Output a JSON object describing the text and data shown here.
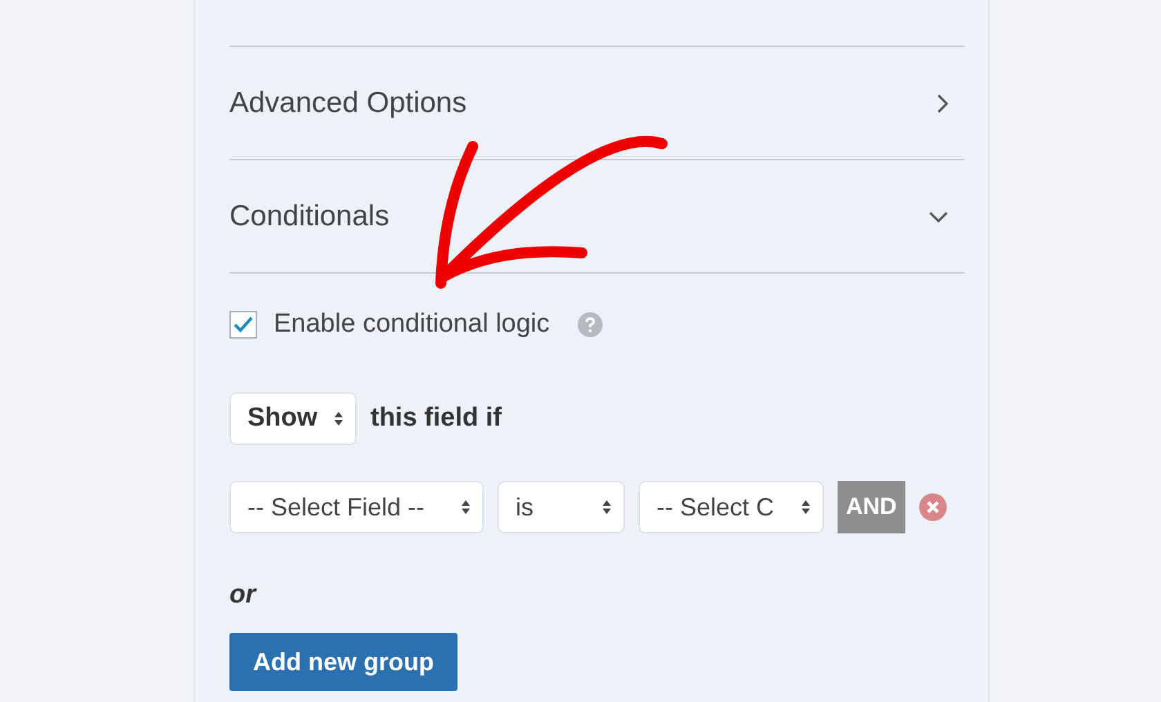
{
  "sections": [
    {
      "title": "Advanced Options",
      "expanded": false
    },
    {
      "title": "Conditionals",
      "expanded": true
    }
  ],
  "conditional": {
    "label": "Enable conditional logic",
    "checked": true
  },
  "action": {
    "value": "Show",
    "suffix": "this field if"
  },
  "rule": {
    "field": "-- Select Field --",
    "operator": "is",
    "choice": "-- Select C",
    "join": "AND"
  },
  "or_label": "or",
  "add_button": "Add new group"
}
